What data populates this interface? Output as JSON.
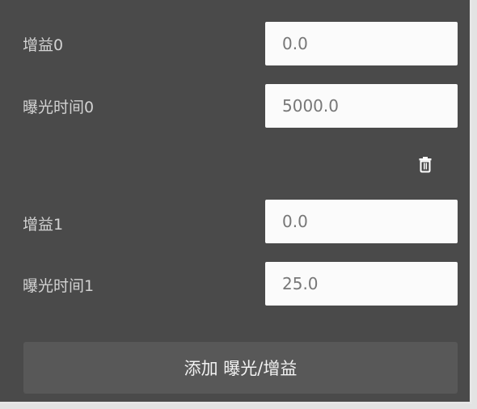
{
  "entries": [
    {
      "gain_label": "增益0",
      "gain_value": "0.0",
      "exposure_label": "曝光时间0",
      "exposure_value": "5000.0"
    },
    {
      "gain_label": "增益1",
      "gain_value": "0.0",
      "exposure_label": "曝光时间1",
      "exposure_value": "25.0"
    }
  ],
  "icons": {
    "delete": "trash-icon"
  },
  "add_button_label": "添加 曝光/增益",
  "colors": {
    "panel_bg": "#4a4a4a",
    "label_text": "#d2d2d2",
    "input_bg": "#fbfbfb",
    "input_text": "#777777",
    "button_bg": "#585858",
    "button_text": "#f2f2f2"
  }
}
